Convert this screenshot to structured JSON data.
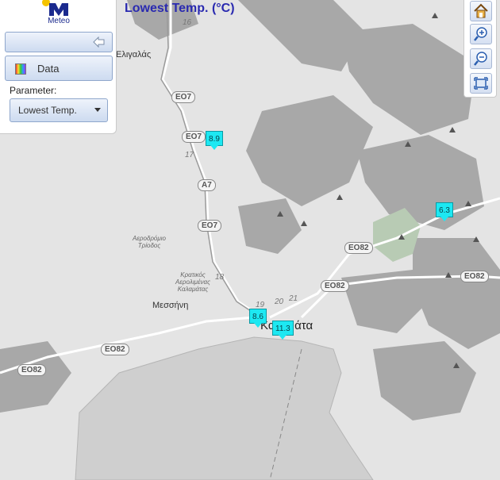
{
  "map_title": "Lowest Temp. (°C)",
  "panel": {
    "logo_text": "Meteo",
    "data_button_label": "Data",
    "parameter_label": "Parameter:",
    "parameter_selected": "Lowest Temp."
  },
  "toolbar": {
    "icons": [
      "home-icon",
      "zoom-in-icon",
      "zoom-out-icon",
      "full-extent-icon"
    ]
  },
  "temperature_markers": [
    "8.9",
    "6.3",
    "8.6",
    "11.3"
  ],
  "map_labels": {
    "town_1": "Ελιγαλάς",
    "town_2": "Μεσσήνη",
    "city": "Καλαμάτα",
    "airport": "Αεροδρόμιο Τρίοδος",
    "airport_2": "Κρατικός Αερολιμένας Καλαμάτας",
    "num_16": "16",
    "num_17": "17",
    "num_18": "18",
    "num_19": "19",
    "num_20": "20",
    "num_21": "21"
  },
  "road_labels": [
    "EO7",
    "EO7",
    "A7",
    "EO7",
    "EO82",
    "EO82",
    "EO82",
    "EO82",
    "EO82"
  ],
  "colors": {
    "title": "#2a2ab0",
    "marker_fill": "#1de8f2",
    "sea": "#cfcfcf",
    "land": "#e4e4e4",
    "terrain": "#9b9b9b"
  }
}
